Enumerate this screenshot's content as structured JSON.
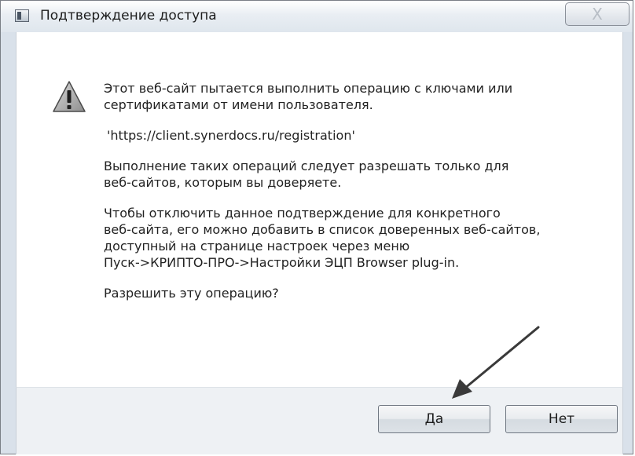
{
  "window": {
    "title": "Подтверждение доступа",
    "close_label": "X"
  },
  "message": {
    "line1": "Этот веб-сайт пытается выполнить операцию с ключами или",
    "line2": "сертификатами от имени пользователя.",
    "url": "'https://client.synerdocs.ru/registration'",
    "line3": "Выполнение таких операций следует разрешать только для",
    "line4": "веб-сайтов, которым вы доверяете.",
    "line5": "Чтобы отключить данное подтверждение для конкретного",
    "line6": "веб-сайта, его можно добавить в список доверенных веб-сайтов,",
    "line7": "доступный на странице настроек через меню",
    "line8": "Пуск->КРИПТО-ПРО->Настройки ЭЦП Browser plug-in.",
    "question": "Разрешить эту операцию?"
  },
  "buttons": {
    "yes": "Да",
    "no": "Нет"
  },
  "icons": {
    "warning": "warning-triangle-icon",
    "app": "app-icon",
    "close": "close-icon",
    "annotation": "pointer-arrow-icon"
  }
}
